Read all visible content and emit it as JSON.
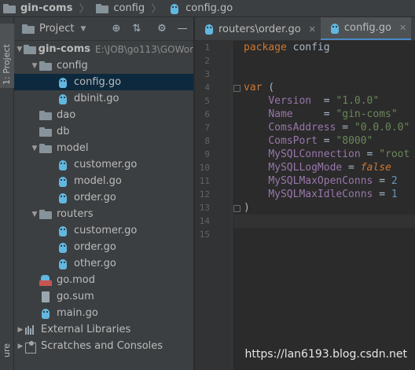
{
  "breadcrumb": {
    "items": [
      {
        "label": "gin-coms",
        "icon": "folder-icon"
      },
      {
        "label": "config",
        "icon": "folder-icon"
      },
      {
        "label": "config.go",
        "icon": "go-file-icon"
      }
    ]
  },
  "left_strip": {
    "project_tab_label": "1: Project",
    "bottom_label": "ure"
  },
  "project_panel": {
    "title": "Project",
    "tree": [
      {
        "label": "gin-coms",
        "path": "E:\\JOB\\go113\\GOWor",
        "kind": "folder",
        "depth": 0,
        "expanded": true,
        "bold": true
      },
      {
        "label": "config",
        "kind": "folder",
        "depth": 1,
        "expanded": true
      },
      {
        "label": "config.go",
        "kind": "go",
        "depth": 2,
        "selected": true
      },
      {
        "label": "dbinit.go",
        "kind": "go",
        "depth": 2
      },
      {
        "label": "dao",
        "kind": "folder",
        "depth": 1
      },
      {
        "label": "db",
        "kind": "folder",
        "depth": 1
      },
      {
        "label": "model",
        "kind": "folder",
        "depth": 1,
        "expanded": true
      },
      {
        "label": "customer.go",
        "kind": "go",
        "depth": 2
      },
      {
        "label": "model.go",
        "kind": "go",
        "depth": 2
      },
      {
        "label": "order.go",
        "kind": "go",
        "depth": 2
      },
      {
        "label": "routers",
        "kind": "folder",
        "depth": 1,
        "expanded": true
      },
      {
        "label": "customer.go",
        "kind": "go",
        "depth": 2
      },
      {
        "label": "order.go",
        "kind": "go",
        "depth": 2
      },
      {
        "label": "other.go",
        "kind": "go",
        "depth": 2
      },
      {
        "label": "go.mod",
        "kind": "mod",
        "depth": 1
      },
      {
        "label": "go.sum",
        "kind": "sum",
        "depth": 1
      },
      {
        "label": "main.go",
        "kind": "go",
        "depth": 1
      },
      {
        "label": "External Libraries",
        "kind": "lib",
        "depth": 0,
        "collapsed": true
      },
      {
        "label": "Scratches and Consoles",
        "kind": "scratch",
        "depth": 0,
        "collapsed": true
      }
    ]
  },
  "editor": {
    "tabs": [
      {
        "label": "routers\\order.go",
        "active": false
      },
      {
        "label": "config.go",
        "active": true
      }
    ],
    "line_numbers": [
      "1",
      "2",
      "3",
      "4",
      "5",
      "6",
      "7",
      "8",
      "9",
      "10",
      "11",
      "12",
      "13",
      "14",
      "15"
    ],
    "current_line": 14,
    "code": {
      "l1_kw": "package",
      "l1_name": " config",
      "l4_kw": "var",
      "l4_paren": " (",
      "l5_id": "Version",
      "l5_eq": "  = ",
      "l5_val": "\"1.0.0\"",
      "l6_id": "Name",
      "l6_eq": "     = ",
      "l6_val": "\"gin-coms\"",
      "l7_id": "ComsAddress",
      "l7_eq": " = ",
      "l7_val": "\"0.0.0.0\"",
      "l8_id": "ComsPort",
      "l8_eq": " = ",
      "l8_val": "\"8000\"",
      "l9_id": "MySQLConnection",
      "l9_eq": " = ",
      "l9_val": "\"root",
      "l10_id": "MySQLLogMode",
      "l10_eq": " = ",
      "l10_val": "false",
      "l11_id": "MySQLMaxOpenConns",
      "l11_eq": " = ",
      "l11_val": "2",
      "l12_id": "MySQLMaxIdleConns",
      "l12_eq": " = ",
      "l12_val": "1",
      "l13": ")"
    }
  },
  "watermark": "https://lan6193.blog.csdn.net"
}
